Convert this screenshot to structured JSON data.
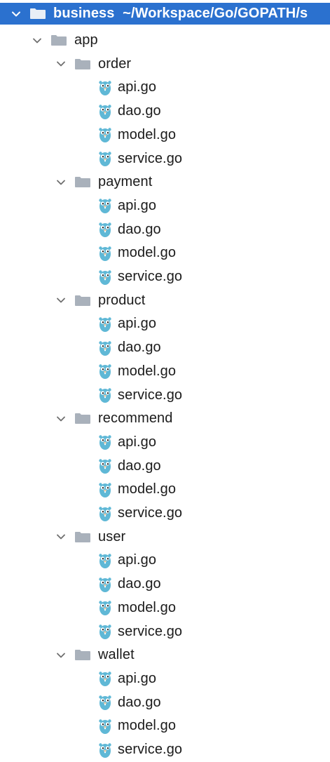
{
  "root": {
    "name": "business",
    "path": "~/Workspace/Go/GOPATH/s",
    "expanded": true
  },
  "app_folder": {
    "name": "app",
    "expanded": true
  },
  "folders": [
    {
      "name": "order",
      "files": [
        "api.go",
        "dao.go",
        "model.go",
        "service.go"
      ]
    },
    {
      "name": "payment",
      "files": [
        "api.go",
        "dao.go",
        "model.go",
        "service.go"
      ]
    },
    {
      "name": "product",
      "files": [
        "api.go",
        "dao.go",
        "model.go",
        "service.go"
      ]
    },
    {
      "name": "recommend",
      "files": [
        "api.go",
        "dao.go",
        "model.go",
        "service.go"
      ]
    },
    {
      "name": "user",
      "files": [
        "api.go",
        "dao.go",
        "model.go",
        "service.go"
      ]
    },
    {
      "name": "wallet",
      "files": [
        "api.go",
        "dao.go",
        "model.go",
        "service.go"
      ]
    }
  ],
  "icons": {
    "chevron": "chevron-down-icon",
    "folder": "folder-icon",
    "file": "go-gopher-icon"
  },
  "colors": {
    "selection": "#2b71cf",
    "folder": "#a9b1bb",
    "gopher": "#5fb8d6"
  }
}
